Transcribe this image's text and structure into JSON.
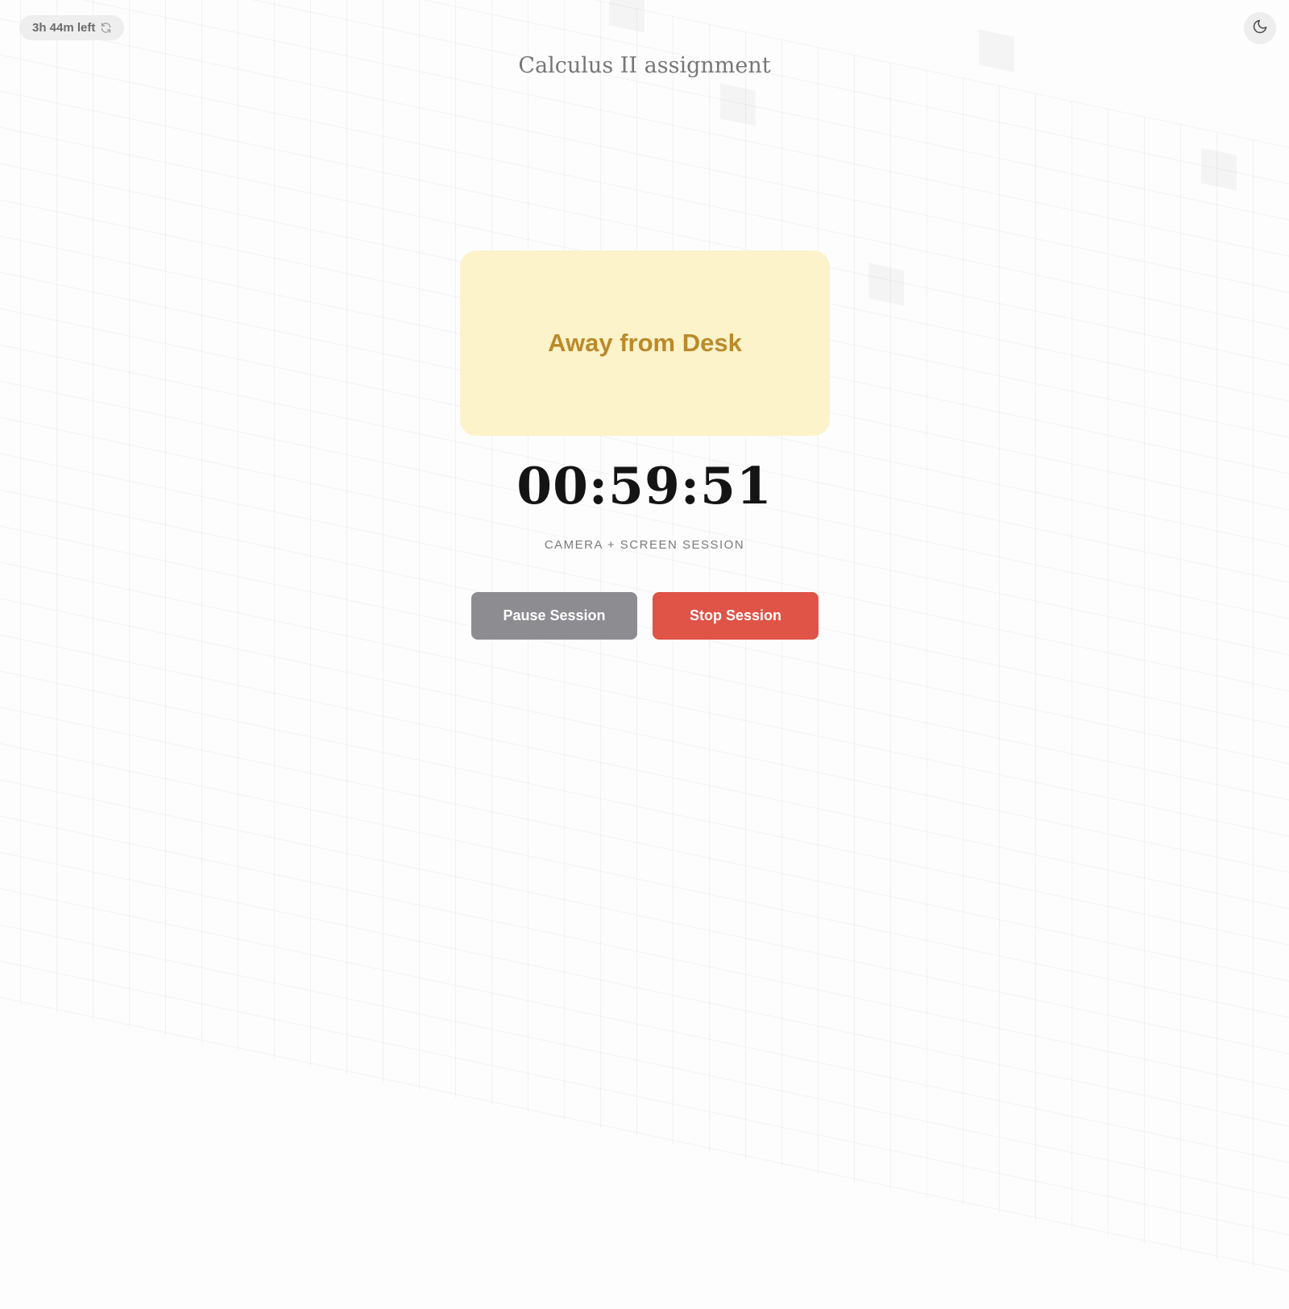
{
  "header": {
    "time_left": "3h 44m left",
    "refresh_icon": "refresh-icon",
    "theme_icon": "moon-icon"
  },
  "session": {
    "title": "Calculus II assignment",
    "status": "Away from Desk",
    "timer": "00:59:51",
    "mode": "CAMERA + SCREEN SESSION"
  },
  "actions": {
    "pause_label": "Pause Session",
    "stop_label": "Stop Session"
  },
  "colors": {
    "status_bg": "#fcf3ca",
    "status_text": "#bb8a2b",
    "pause_bg": "#8c8c91",
    "stop_bg": "#e05347"
  }
}
